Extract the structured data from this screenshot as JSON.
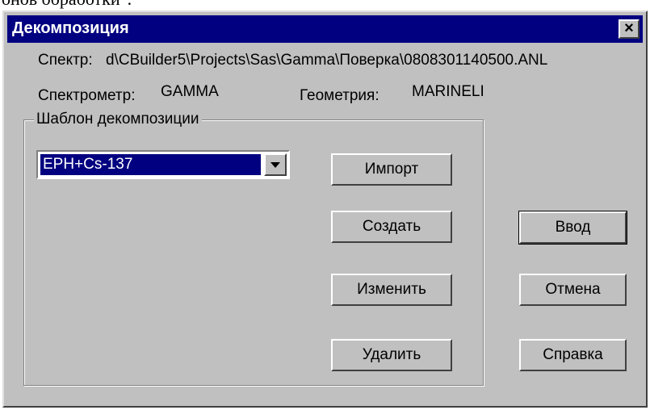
{
  "background_text": "онов обработки\".",
  "window": {
    "title": "Декомпозиция",
    "close_label": "×"
  },
  "info": {
    "spectrum_label": "Спектр:",
    "spectrum_value": "d\\CBuilder5\\Projects\\Sas\\Gamma\\Поверка\\0808301140500.ANL",
    "spectrometer_label": "Спектрометр:",
    "spectrometer_value": "GAMMA",
    "geometry_label": "Геометрия:",
    "geometry_value": "MARINELI"
  },
  "template_group": {
    "label": "Шаблон декомпозиции",
    "selected": "ЕРН+Cs-137",
    "import_label": "Импорт",
    "create_label": "Создать",
    "edit_label": "Изменить",
    "delete_label": "Удалить"
  },
  "actions": {
    "ok_label": "Ввод",
    "cancel_label": "Отмена",
    "help_label": "Справка"
  },
  "colors": {
    "titlebar": "#000080",
    "face": "#c0c0c0",
    "selection": "#000080"
  }
}
